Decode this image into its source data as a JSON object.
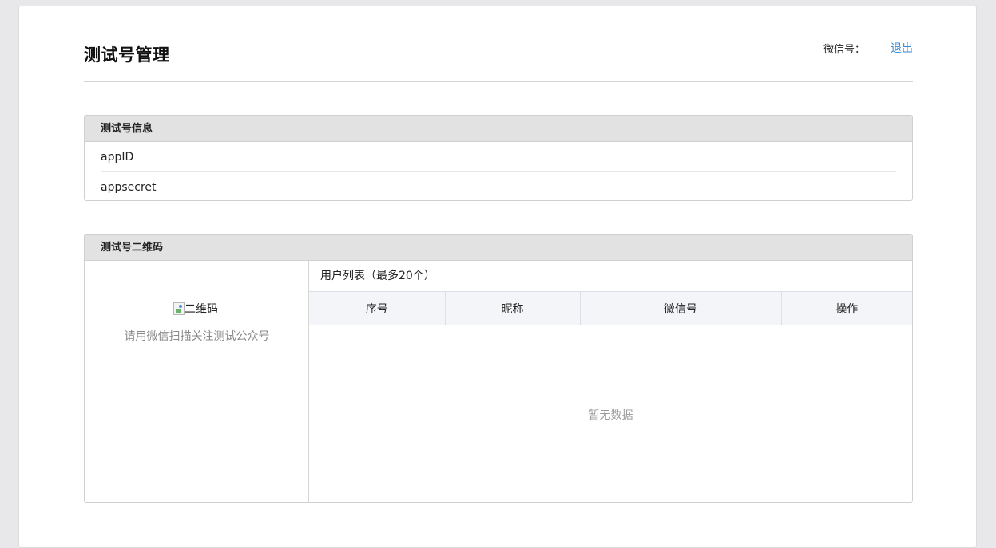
{
  "header": {
    "title": "测试号管理",
    "wechat_label": "微信号：",
    "logout": "退出"
  },
  "info_panel": {
    "title": "测试号信息",
    "rows": [
      "appID",
      "appsecret"
    ]
  },
  "qr_panel": {
    "title": "测试号二维码",
    "qr_alt": "二维码",
    "qr_caption": "请用微信扫描关注测试公众号",
    "user_list": {
      "title": "用户列表（最多20个）",
      "columns": [
        "序号",
        "昵称",
        "微信号",
        "操作"
      ],
      "rows": [],
      "empty_text": "暂无数据"
    }
  }
}
